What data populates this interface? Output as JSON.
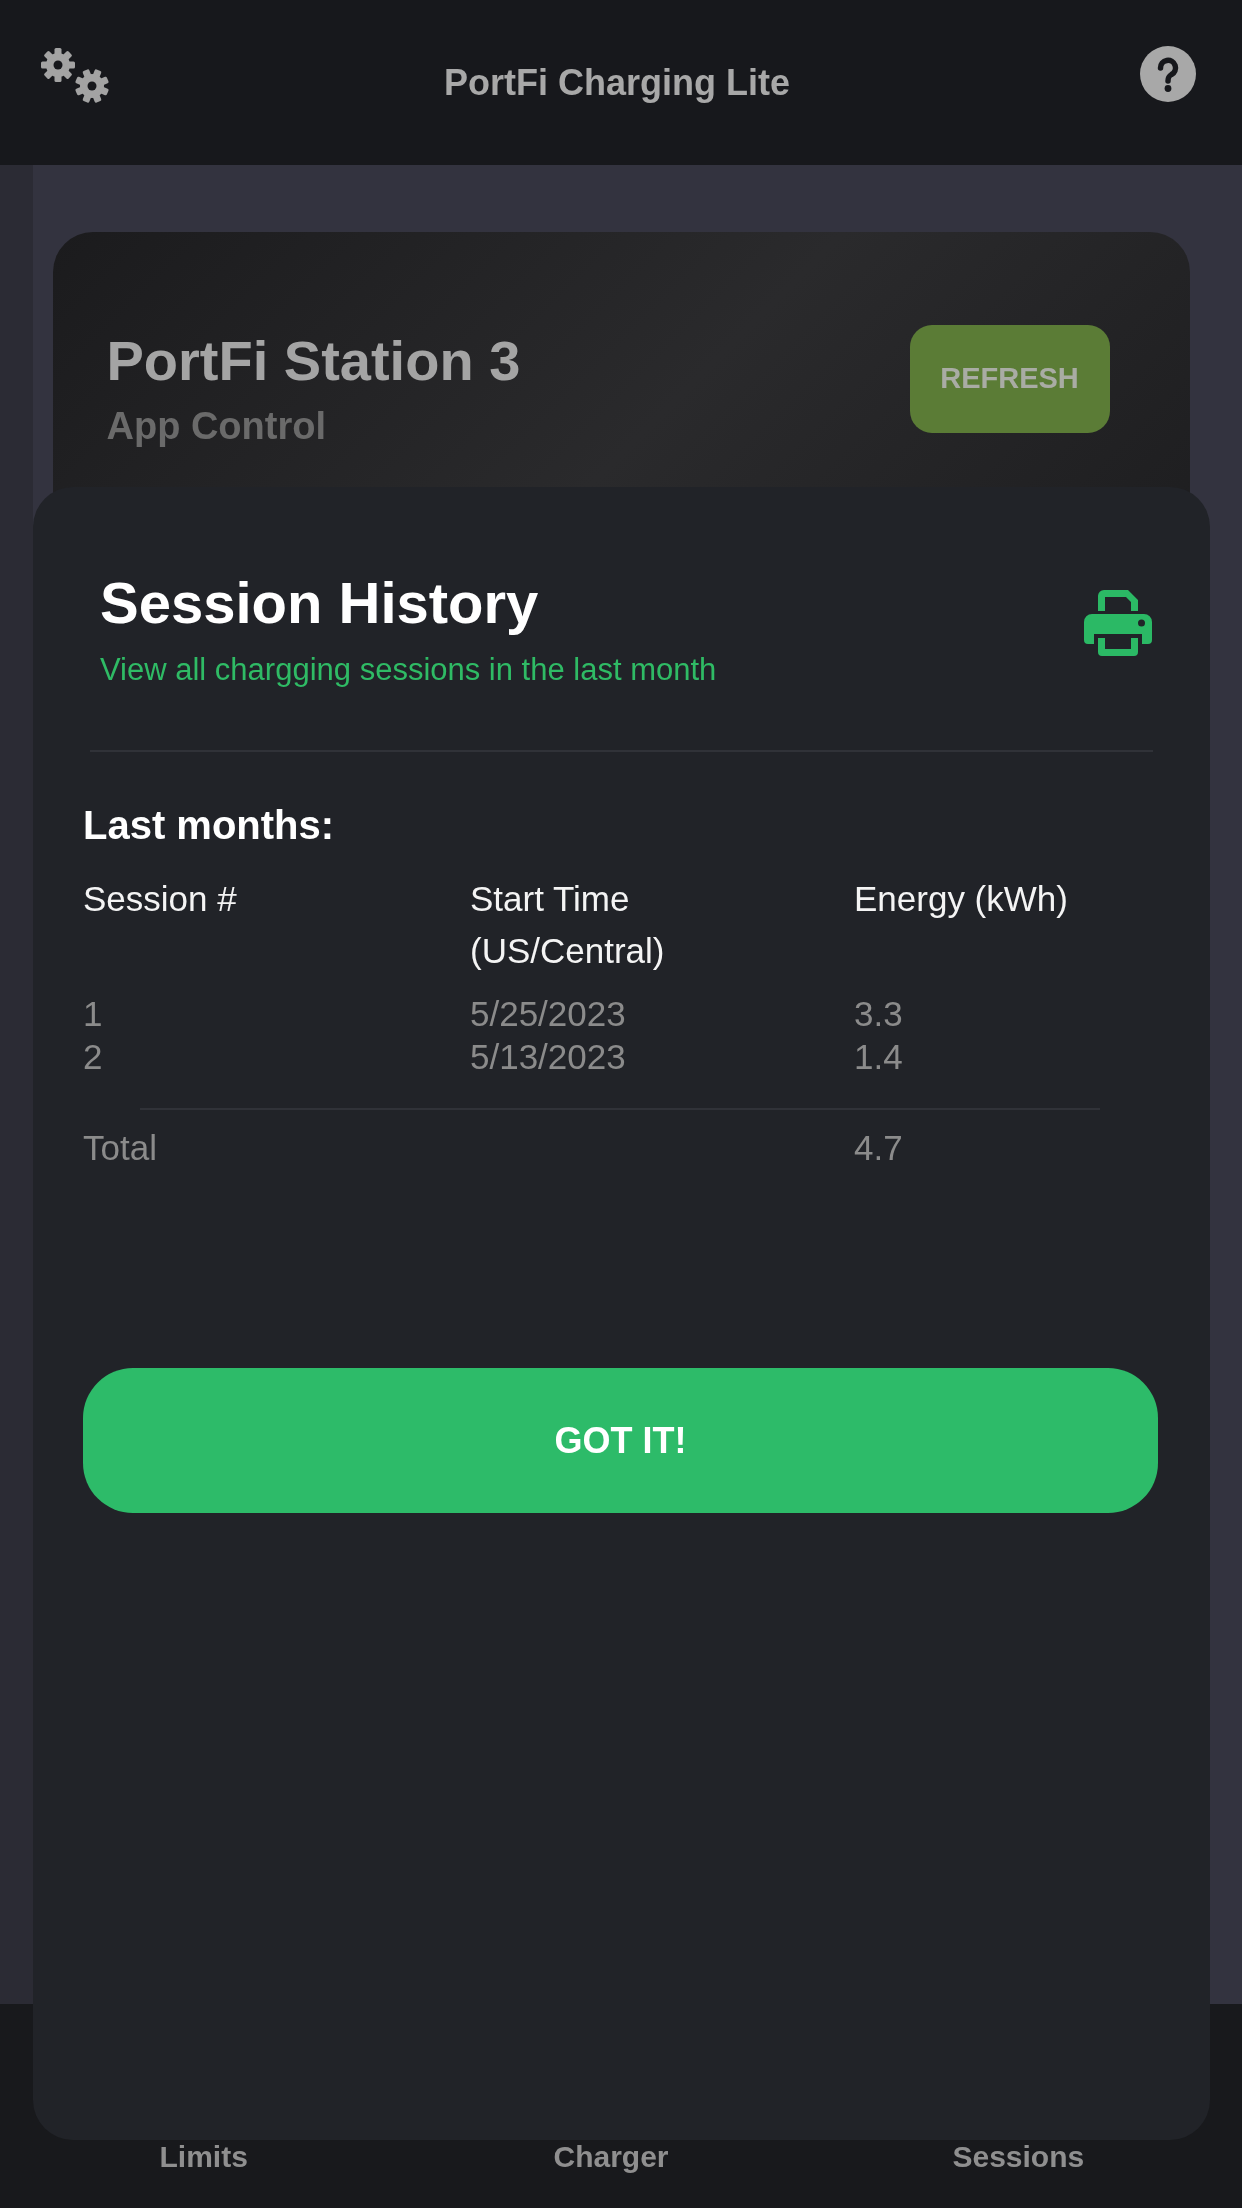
{
  "top_bar": {
    "title": "PortFi Charging Lite"
  },
  "station_card": {
    "name": "PortFi Station 3",
    "mode": "App Control",
    "refresh_button": "REFRESH"
  },
  "session_dialog": {
    "title": "Session History",
    "subtitle": "View all chargging sessions in the last month",
    "section_title": "Last months:",
    "table": {
      "columns": [
        "Session #",
        "Start Time (US/Central)",
        "Energy (kWh)"
      ],
      "rows": [
        [
          "1",
          "5/25/2023",
          "3.3"
        ],
        [
          "2",
          "5/13/2023",
          "1.4"
        ]
      ],
      "total": {
        "label": "Total",
        "energy": "4.7"
      }
    },
    "button": "GOT IT!"
  },
  "bottom_nav": {
    "items": [
      {
        "label": "Limits",
        "selected": false
      },
      {
        "label": "Charger",
        "selected": false
      },
      {
        "label": "Sessions",
        "selected": false
      }
    ]
  }
}
